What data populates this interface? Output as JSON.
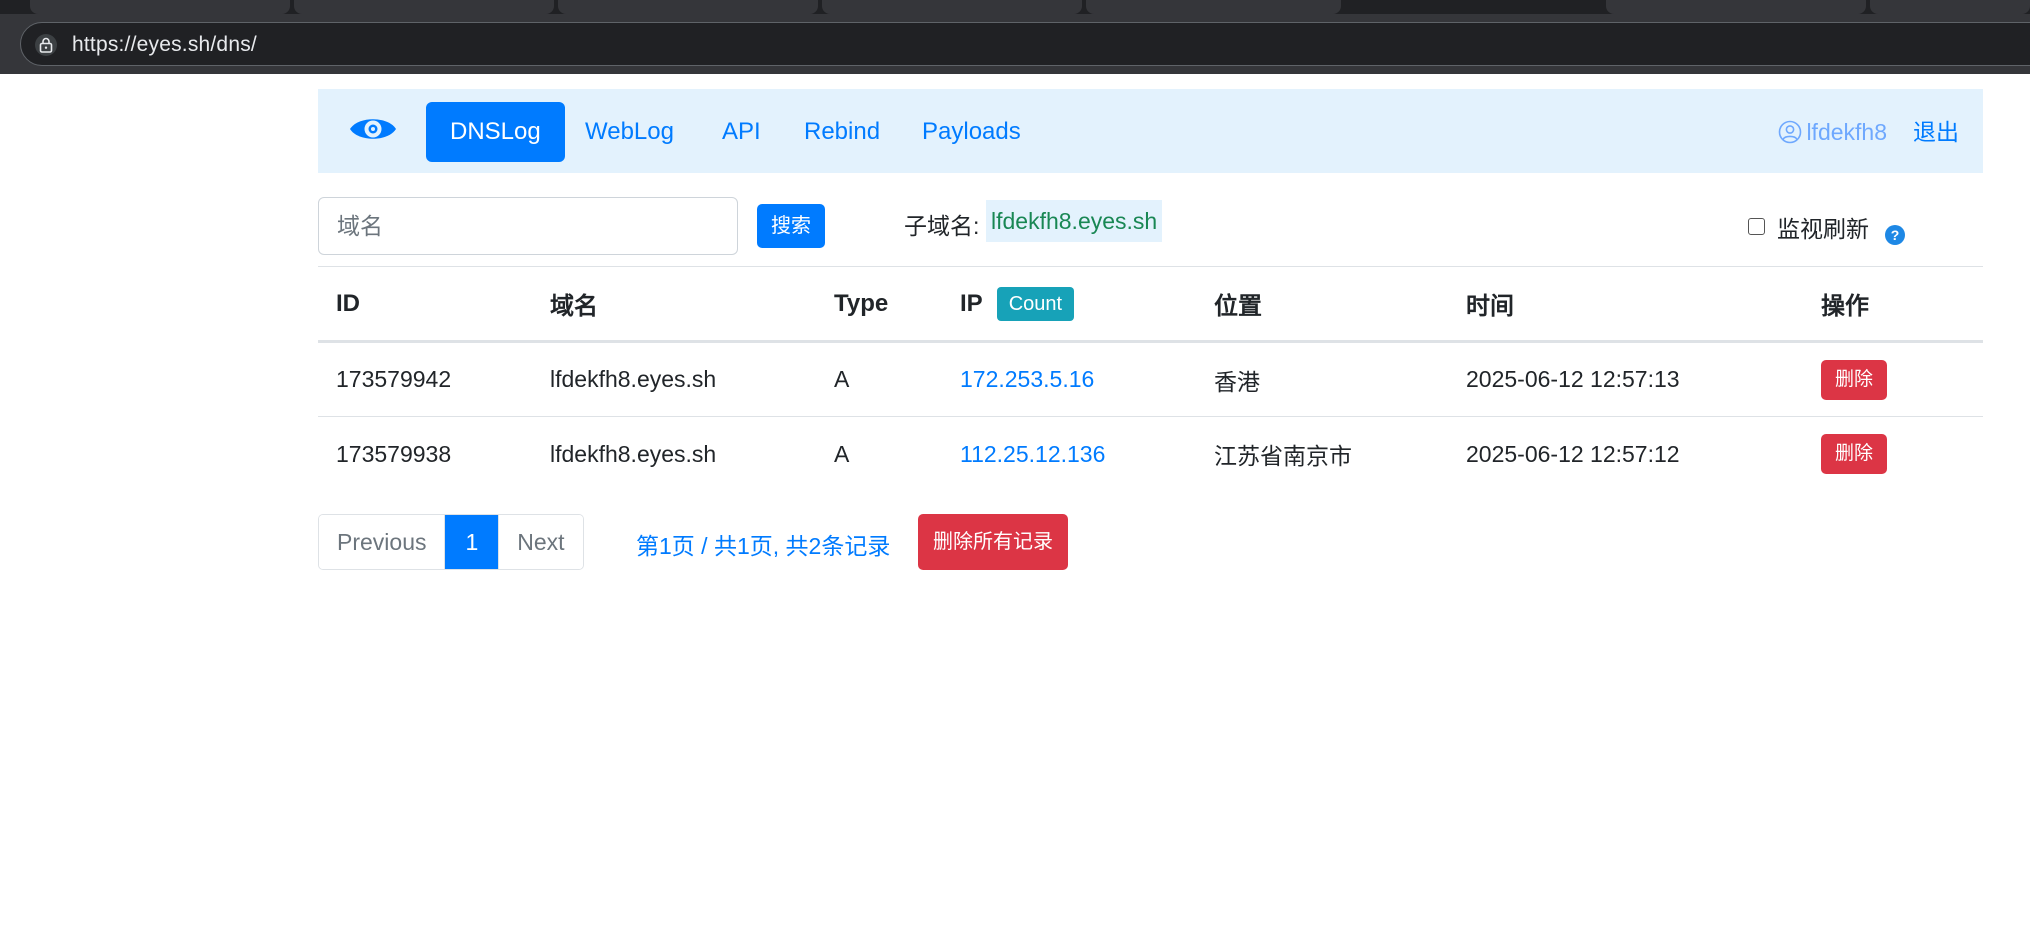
{
  "browser": {
    "url": "https://eyes.sh/dns/"
  },
  "navbar": {
    "items": [
      {
        "label": "DNSLog",
        "active": true
      },
      {
        "label": "WebLog"
      },
      {
        "label": "API"
      },
      {
        "label": "Rebind"
      },
      {
        "label": "Payloads"
      }
    ],
    "username": "lfdekfh8",
    "logout_label": "退出"
  },
  "search": {
    "placeholder": "域名",
    "button_label": "搜索"
  },
  "subdomain": {
    "label": "子域名:",
    "value": "lfdekfh8.eyes.sh"
  },
  "monitor": {
    "label": "监视刷新",
    "checked": false,
    "help_glyph": "?"
  },
  "table": {
    "headers": [
      "ID",
      "域名",
      "Type",
      "IP",
      "位置",
      "时间",
      "操作"
    ],
    "count_badge": "Count",
    "rows": [
      {
        "id": "173579942",
        "domain": "lfdekfh8.eyes.sh",
        "type": "A",
        "ip": "172.253.5.16",
        "location": "香港",
        "time": "2025-06-12 12:57:13",
        "action": "删除"
      },
      {
        "id": "173579938",
        "domain": "lfdekfh8.eyes.sh",
        "type": "A",
        "ip": "112.25.12.136",
        "location": "江苏省南京市",
        "time": "2025-06-12 12:57:12",
        "action": "删除"
      }
    ]
  },
  "pagination": {
    "previous": "Previous",
    "current": "1",
    "next": "Next",
    "info": "第1页 / 共1页, 共2条记录",
    "delete_all": "删除所有记录"
  },
  "colors": {
    "primary": "#007bff",
    "danger": "#dc3545",
    "info": "#17a2b8",
    "navbar_bg": "#e3f2fd",
    "subdomain_text": "#198754"
  }
}
